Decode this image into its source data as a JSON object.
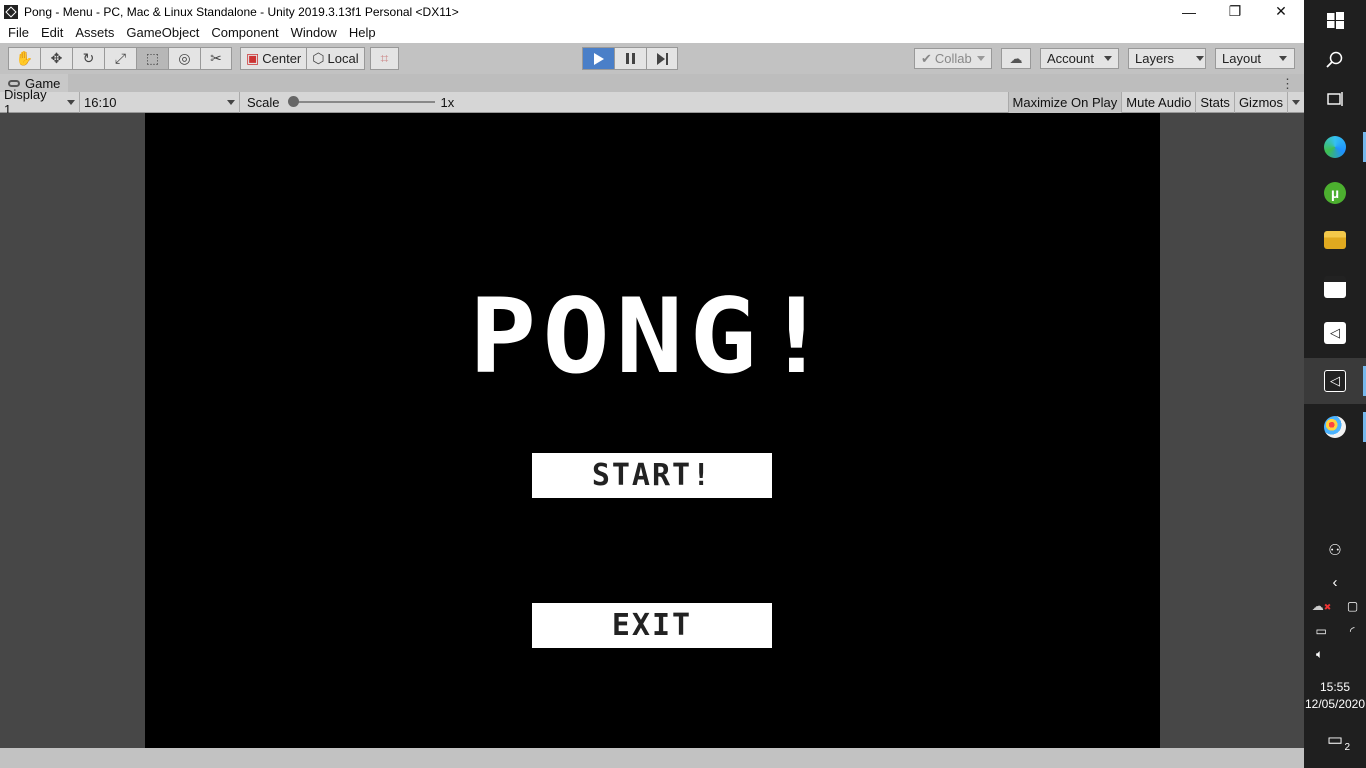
{
  "window": {
    "title": "Pong - Menu - PC, Mac & Linux Standalone - Unity 2019.3.13f1 Personal <DX11>",
    "minimize": "—",
    "maximize": "❐",
    "close": "✕"
  },
  "menu": [
    "File",
    "Edit",
    "Assets",
    "GameObject",
    "Component",
    "Window",
    "Help"
  ],
  "toolbar": {
    "pivot_label": "Center",
    "space_label": "Local",
    "collab_label": "Collab",
    "account_label": "Account",
    "layers_label": "Layers",
    "layout_label": "Layout"
  },
  "tab": {
    "label": "Game",
    "menu_glyph": "⋮"
  },
  "gamebar": {
    "display": "Display 1",
    "aspect": "16:10",
    "scale_label": "Scale",
    "scale_value": "1x",
    "scale_fraction": 0.0,
    "maximize_on_play": "Maximize On Play",
    "mute_audio": "Mute Audio",
    "stats": "Stats",
    "gizmos": "Gizmos"
  },
  "game": {
    "title": "PONG!",
    "start_label": "START!",
    "exit_label": "EXIT"
  },
  "taskbar": {
    "time": "15:55",
    "date": "12/05/2020",
    "notification_count": "2"
  },
  "colors": {
    "play_active": "#4a7fc8",
    "editor_gray": "#c2c2c2",
    "game_background": "#000000",
    "taskbar": "#1f1f1f"
  }
}
